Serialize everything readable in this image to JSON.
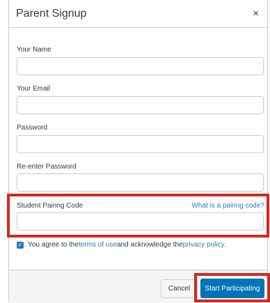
{
  "dialog": {
    "title": "Parent Signup",
    "close_glyph": "×",
    "close_icon": "close-icon"
  },
  "form": {
    "name": {
      "label": "Your Name",
      "value": ""
    },
    "email": {
      "label": "Your Email",
      "value": ""
    },
    "password": {
      "label": "Password",
      "value": ""
    },
    "confirm_password": {
      "label": "Re-enter Password",
      "value": ""
    },
    "pairing": {
      "label": "Student Pairing Code",
      "help_link": "What is a pairing code?",
      "value": ""
    }
  },
  "agreement": {
    "checked": true,
    "check_glyph": "✓",
    "prefix": "You agree to the ",
    "terms_link": "terms of use",
    "middle": " and acknowledge the ",
    "privacy_link": "privacy policy",
    "suffix": "."
  },
  "footer": {
    "cancel_label": "Cancel",
    "submit_label": "Start Participating"
  },
  "colors": {
    "accent": "#0374b5",
    "link": "#2b7abc",
    "highlight": "#d4291c"
  }
}
